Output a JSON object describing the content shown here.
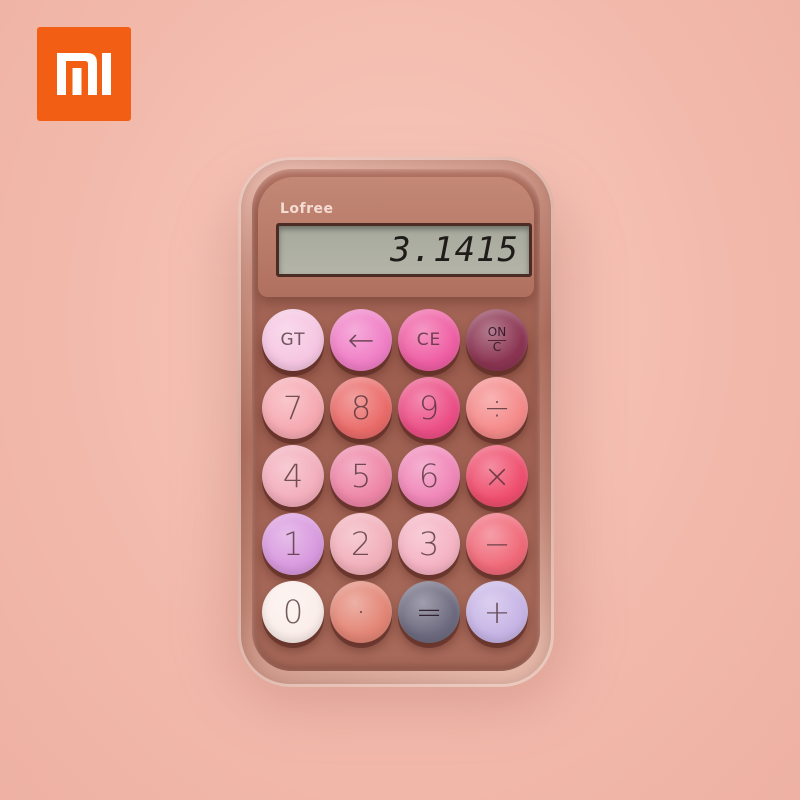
{
  "brand": {
    "logo_text": "mi",
    "logo_color": "#f25f14"
  },
  "calculator": {
    "brand": "Lofree",
    "display_value": "3.1415",
    "keys": [
      {
        "label": "GT",
        "name": "key-gt",
        "color": "#f6c6e2",
        "size": "small"
      },
      {
        "label": "←",
        "name": "key-backspace",
        "color": "#f07fc6",
        "size": "big"
      },
      {
        "label": "CE",
        "name": "key-ce",
        "color": "#ef5fa4",
        "size": "small"
      },
      {
        "label": "ON/C",
        "name": "key-on-c",
        "color": "#8c3552",
        "size": "oc"
      },
      {
        "label": "7",
        "name": "key-7",
        "color": "#f6a9b1",
        "size": "big"
      },
      {
        "label": "8",
        "name": "key-8",
        "color": "#ea6c6a",
        "size": "big"
      },
      {
        "label": "9",
        "name": "key-9",
        "color": "#ec4f86",
        "size": "big"
      },
      {
        "label": "÷",
        "name": "key-divide",
        "color": "#f58a8a",
        "size": "big"
      },
      {
        "label": "4",
        "name": "key-4",
        "color": "#f3aebc",
        "size": "big"
      },
      {
        "label": "5",
        "name": "key-5",
        "color": "#ee86a8",
        "size": "big"
      },
      {
        "label": "6",
        "name": "key-6",
        "color": "#f087b8",
        "size": "big"
      },
      {
        "label": "×",
        "name": "key-multiply",
        "color": "#ef4f6e",
        "size": "big"
      },
      {
        "label": "1",
        "name": "key-1",
        "color": "#d99adf",
        "size": "big"
      },
      {
        "label": "2",
        "name": "key-2",
        "color": "#f2b0bb",
        "size": "big"
      },
      {
        "label": "3",
        "name": "key-3",
        "color": "#f5b3c4",
        "size": "big"
      },
      {
        "label": "−",
        "name": "key-minus",
        "color": "#f06a79",
        "size": "big"
      },
      {
        "label": "0",
        "name": "key-0",
        "color": "#fbeeea",
        "size": "big"
      },
      {
        "label": "·",
        "name": "key-decimal",
        "color": "#e38676",
        "size": "big"
      },
      {
        "label": "=",
        "name": "key-equals",
        "color": "#6e6b80",
        "size": "big"
      },
      {
        "label": "+",
        "name": "key-plus",
        "color": "#c7b5e6",
        "size": "big"
      }
    ]
  }
}
